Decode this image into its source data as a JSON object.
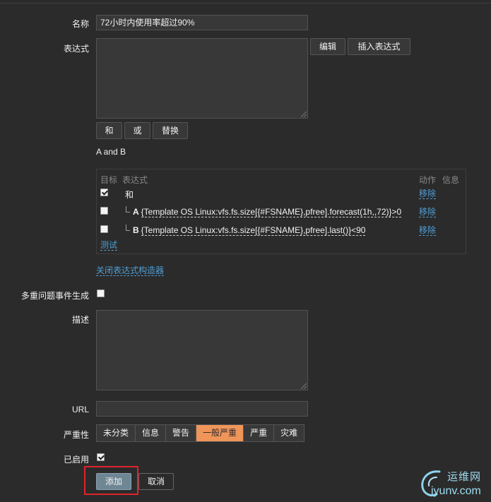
{
  "form": {
    "name_label": "名称",
    "name_value": "72小时内使用率超过90%",
    "expression_label": "表达式",
    "edit_button": "编辑",
    "insert_expression_button": "插入表达式",
    "and_button": "和",
    "or_button": "或",
    "replace_button": "替换",
    "expression_summary": "A and B",
    "builder": {
      "header_target": "目标",
      "header_expression": "表达式",
      "header_action": "动作",
      "header_info": "信息",
      "rows": [
        {
          "checked": true,
          "letter": "",
          "expression": "和",
          "action": "移除"
        },
        {
          "checked": false,
          "letter": "A",
          "expression": "{Template OS Linux:vfs.fs.size[{#FSNAME},pfree].forecast(1h,,72)}>0",
          "action": "移除"
        },
        {
          "checked": false,
          "letter": "B",
          "expression": "{Template OS Linux:vfs.fs.size[{#FSNAME},pfree].last()}<90",
          "action": "移除"
        }
      ],
      "test_link": "测试"
    },
    "close_builder_link": "关闭表达式构造器",
    "multiple_events_label": "多重问题事件生成",
    "multiple_events_checked": false,
    "description_label": "描述",
    "url_label": "URL",
    "url_value": "",
    "severity_label": "严重性",
    "severity_options": [
      "未分类",
      "信息",
      "警告",
      "一般严重",
      "严重",
      "灾难"
    ],
    "severity_selected": "一般严重",
    "enabled_label": "已启用",
    "enabled_checked": true,
    "add_button": "添加",
    "cancel_button": "取消"
  },
  "watermark": {
    "line1": "运维网",
    "line2": "iyunv.com",
    "color": "#9fdcf0"
  },
  "colors": {
    "background": "#2b2b2b",
    "link": "#4f9fd6",
    "active_severity": "#f0955a",
    "highlight_border": "#e0232b"
  }
}
